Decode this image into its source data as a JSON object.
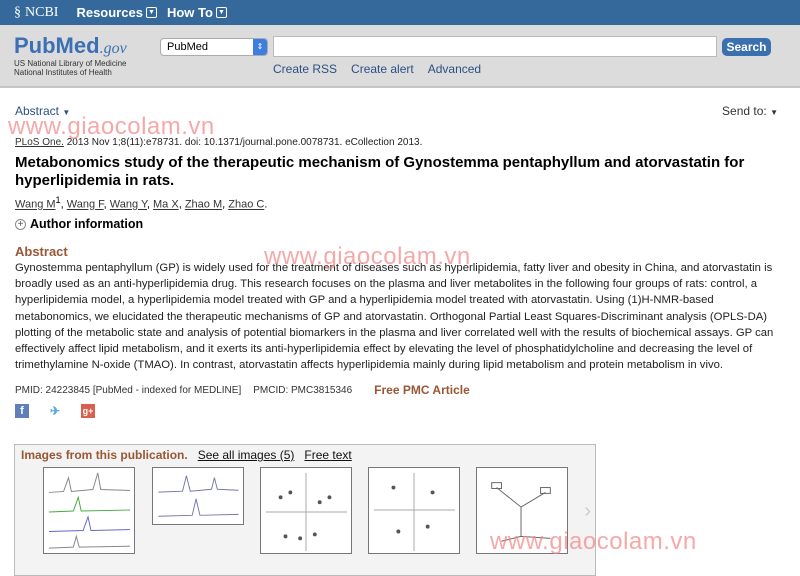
{
  "topbar": {
    "brand": "NCBI",
    "menus": [
      "Resources",
      "How To"
    ]
  },
  "header": {
    "logo": "PubMed",
    "logo_suffix": ".gov",
    "org_lines": [
      "US National Library of Medicine",
      "National Institutes of Health"
    ],
    "database_select": "PubMed",
    "search_value": "",
    "search_button": "Search",
    "links": [
      "Create RSS",
      "Create alert",
      "Advanced"
    ]
  },
  "display": {
    "format": "Abstract",
    "send_to": "Send to:"
  },
  "watermark": "www.giaocolam.vn",
  "article": {
    "journal": "PLoS One.",
    "citation": " 2013 Nov 1;8(11):e78731. doi: 10.1371/journal.pone.0078731. eCollection 2013.",
    "title": "Metabonomics study of the therapeutic mechanism of Gynostemma pentaphyllum and atorvastatin for hyperlipidemia in rats.",
    "authors": [
      "Wang M",
      "Wang F",
      "Wang Y",
      "Ma X",
      "Zhao M",
      "Zhao C"
    ],
    "first_author_sup": "1",
    "author_info": "Author information",
    "abstract_heading": "Abstract",
    "abstract": "Gynostemma pentaphyllum (GP) is widely used for the treatment of diseases such as hyperlipidemia, fatty liver and obesity in China, and atorvastatin is broadly used as an anti-hyperlipidemia drug. This research focuses on the plasma and liver metabolites in the following four groups of rats: control, a hyperlipidemia model, a hyperlipidemia model treated with GP and a hyperlipidemia model treated with atorvastatin. Using (1)H-NMR-based metabonomics, we elucidated the therapeutic mechanisms of GP and atorvastatin. Orthogonal Partial Least Squares-Discriminant analysis (OPLS-DA) plotting of the metabolic state and analysis of potential biomarkers in the plasma and liver correlated well with the results of biochemical assays. GP can effectively affect lipid metabolism, and it exerts its anti-hyperlipidemia effect by elevating the level of phosphatidylcholine and decreasing the level of trimethylamine N-oxide (TMAO). In contrast, atorvastatin affects hyperlipidemia mainly during lipid metabolism and protein metabolism in vivo.",
    "pmid": "PMID: 24223845 [PubMed - indexed for MEDLINE]",
    "pmcid": "PMCID: PMC3815346",
    "free_pmc": "Free PMC Article"
  },
  "social": [
    "facebook-icon",
    "twitter-icon",
    "google-plus-icon"
  ],
  "images": {
    "heading": "Images from this publication.",
    "see_all": "See all images (5)",
    "free_text": "Free text",
    "count": 5
  },
  "colors": {
    "topbar": "#35699c",
    "accent": "#985735",
    "link": "#2c4f86",
    "watermark": "#f48c8c"
  }
}
